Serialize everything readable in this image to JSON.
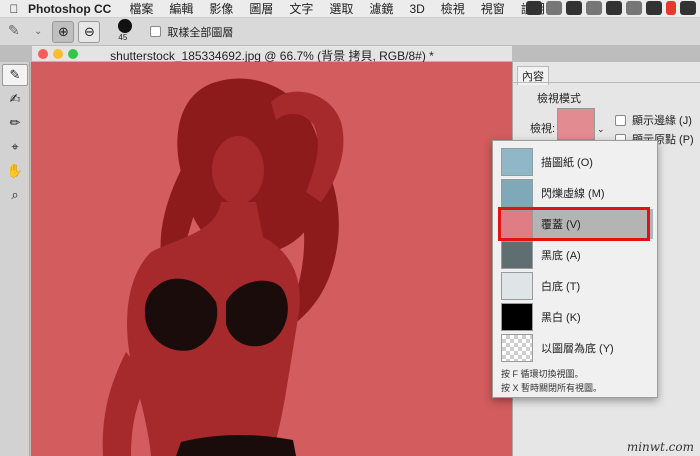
{
  "menubar": {
    "app_name": "Photoshop CC",
    "items": [
      "檔案",
      "編輯",
      "影像",
      "圖層",
      "文字",
      "選取",
      "濾鏡",
      "3D",
      "檢視",
      "視窗",
      "說明"
    ]
  },
  "options_bar": {
    "brush_size": "45",
    "sample_all_layers_label": "取樣全部圖層"
  },
  "document": {
    "title": "shutterstock_185334692.jpg @ 66.7% (背景 拷貝, RGB/8#) *"
  },
  "properties": {
    "tab_label": "內容",
    "section_title": "檢視模式",
    "view_label": "檢視:",
    "show_edge_label": "顯示邊緣 (J)",
    "show_original_label": "顯示原點 (P)"
  },
  "view_menu": {
    "items": [
      {
        "label": "描圖紙 (O)",
        "thumb": "#8fb7c8"
      },
      {
        "label": "閃爍虛線 (M)",
        "thumb": "#7fa9b8"
      },
      {
        "label": "覆蓋 (V)",
        "thumb": "#e07c83"
      },
      {
        "label": "黑底 (A)",
        "thumb": "#5f6e70"
      },
      {
        "label": "白底 (T)",
        "thumb": "#dfe5e6"
      },
      {
        "label": "黑白 (K)",
        "thumb": "#000000"
      },
      {
        "label": "以圖層為底 (Y)",
        "thumb": "#d9d9d9"
      }
    ],
    "selected_index": 2,
    "hint_1": "按 F 循環切換視圖。",
    "hint_2": "按 X 暫時關閉所有視圖。"
  },
  "colors": {
    "overlay": "#d25c5e",
    "highlight": "#e01212"
  },
  "icons": [
    "apple-icon",
    "brush-icon",
    "add-mode-icon",
    "subtract-mode-icon",
    "quick-selection-icon",
    "refine-brush-icon",
    "lasso-icon",
    "hand-icon",
    "zoom-icon"
  ],
  "watermark": "minwt.com"
}
